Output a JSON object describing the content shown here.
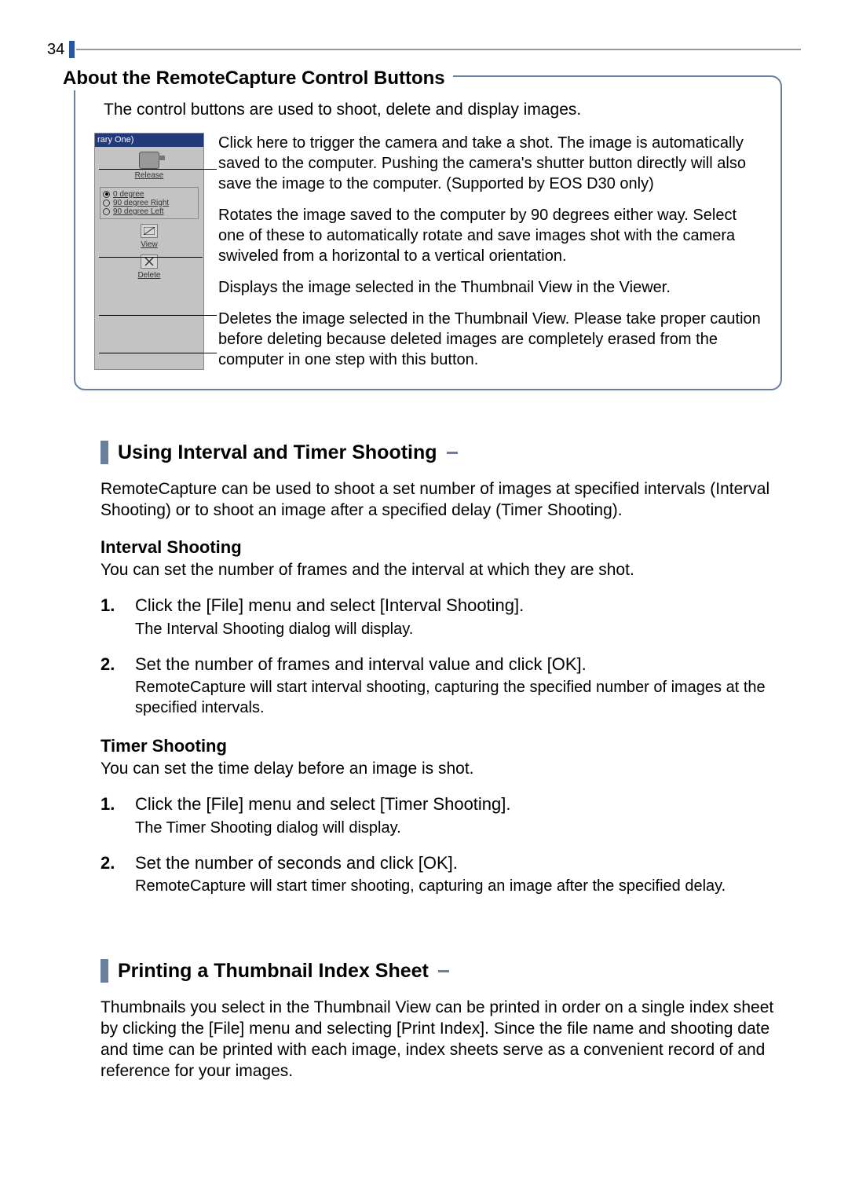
{
  "page_number": "34",
  "callout": {
    "title": "About the RemoteCapture Control Buttons",
    "intro": "The control buttons are used to shoot, delete and display images.",
    "ui": {
      "titlebar": "rary One)",
      "release_label": "Release",
      "rotate": {
        "opt0": "0 degree",
        "opt1": "90 degree Right",
        "opt2": "90 degree Left"
      },
      "view_label": "View",
      "delete_label": "Delete"
    },
    "descriptions": {
      "release": "Click here to trigger the camera and take a shot. The image is automatically saved to the computer. Pushing the camera's shutter button directly will also save the image to the computer. (Supported by EOS D30 only)",
      "rotate": "Rotates the image saved to the computer by 90 degrees either way. Select one of these to automatically rotate and save images shot with the camera swiveled from a horizontal to a vertical orientation.",
      "view": "Displays the image selected in the Thumbnail View in the Viewer.",
      "delete": "Deletes the image selected in the Thumbnail View. Please take proper caution before deleting because deleted images are completely erased from the computer in one step with this button."
    }
  },
  "section1": {
    "title": "Using Interval and Timer Shooting",
    "intro": "RemoteCapture can be used to shoot a set number of images at specified intervals (Interval Shooting) or to shoot an image after a specified delay (Timer Shooting).",
    "interval": {
      "heading": "Interval Shooting",
      "intro": "You can set the number of frames and the interval at which they are shot.",
      "step1_num": "1.",
      "step1_title": "Click the [File] menu and select [Interval Shooting].",
      "step1_desc": "The Interval Shooting dialog will display.",
      "step2_num": "2.",
      "step2_title": "Set the number of frames and interval value and click [OK].",
      "step2_desc": "RemoteCapture will start interval shooting, capturing the specified number of images at the specified intervals."
    },
    "timer": {
      "heading": "Timer Shooting",
      "intro": "You can set the time delay before an image is shot.",
      "step1_num": "1.",
      "step1_title": "Click the [File] menu and select [Timer Shooting].",
      "step1_desc": "The Timer Shooting dialog will display.",
      "step2_num": "2.",
      "step2_title": "Set the number of seconds and click [OK].",
      "step2_desc": "RemoteCapture will start timer shooting, capturing an image after the specified delay."
    }
  },
  "section2": {
    "title": "Printing a Thumbnail Index Sheet",
    "body": "Thumbnails you select in the Thumbnail View can be printed in order on a single index sheet by clicking the [File] menu and selecting [Print Index]. Since the file name and shooting date and time can be printed with each image, index sheets serve as a convenient record of and reference for your images."
  }
}
